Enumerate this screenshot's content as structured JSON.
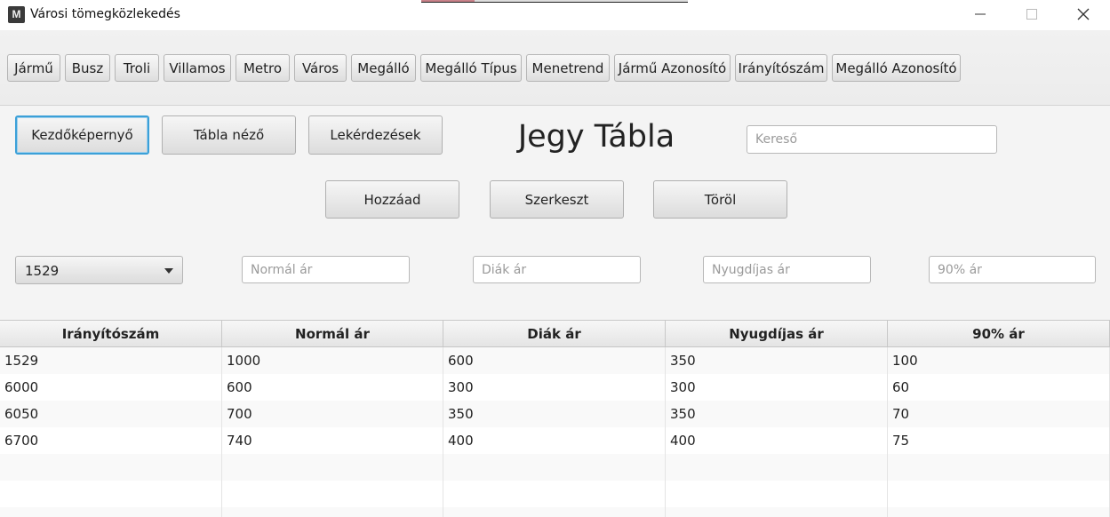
{
  "window": {
    "title": "Városi tömegközlekedés",
    "icon": "app-logo-icon",
    "controls": [
      "minimize-icon",
      "maximize-icon",
      "close-icon"
    ]
  },
  "toolbar": {
    "tabs": [
      "Jármű",
      "Busz",
      "Troli",
      "Villamos",
      "Metro",
      "Város",
      "Megálló",
      "Megálló Típus",
      "Menetrend",
      "Jármű Azonosító",
      "Irányítószám",
      "Megálló Azonosító"
    ]
  },
  "nav": {
    "home": "Kezdőképernyő",
    "table_view": "Tábla néző",
    "queries": "Lekérdezések"
  },
  "page_title": "Jegy Tábla",
  "search": {
    "placeholder": "Kereső",
    "value": ""
  },
  "actions": {
    "add": "Hozzáad",
    "edit": "Szerkeszt",
    "delete": "Töröl"
  },
  "form": {
    "zip_select": "1529",
    "normal_price_placeholder": "Normál ár",
    "student_price_placeholder": "Diák ár",
    "pension_price_placeholder": "Nyugdíjas ár",
    "ninety_price_placeholder": "90% ár"
  },
  "table": {
    "headers": [
      "Irányítószám",
      "Normál ár",
      "Diák ár",
      "Nyugdíjas ár",
      "90% ár"
    ],
    "rows": [
      [
        "1529",
        "1000",
        "600",
        "350",
        "100"
      ],
      [
        "6000",
        "600",
        "300",
        "300",
        "60"
      ],
      [
        "6050",
        "700",
        "350",
        "350",
        "70"
      ],
      [
        "6700",
        "740",
        "400",
        "400",
        "75"
      ],
      [
        "",
        "",
        "",
        "",
        ""
      ],
      [
        "",
        "",
        "",
        "",
        ""
      ],
      [
        "",
        "",
        "",
        "",
        ""
      ]
    ]
  },
  "colors": {
    "focus": "#3ba0d8",
    "background": "#f4f4f4"
  }
}
